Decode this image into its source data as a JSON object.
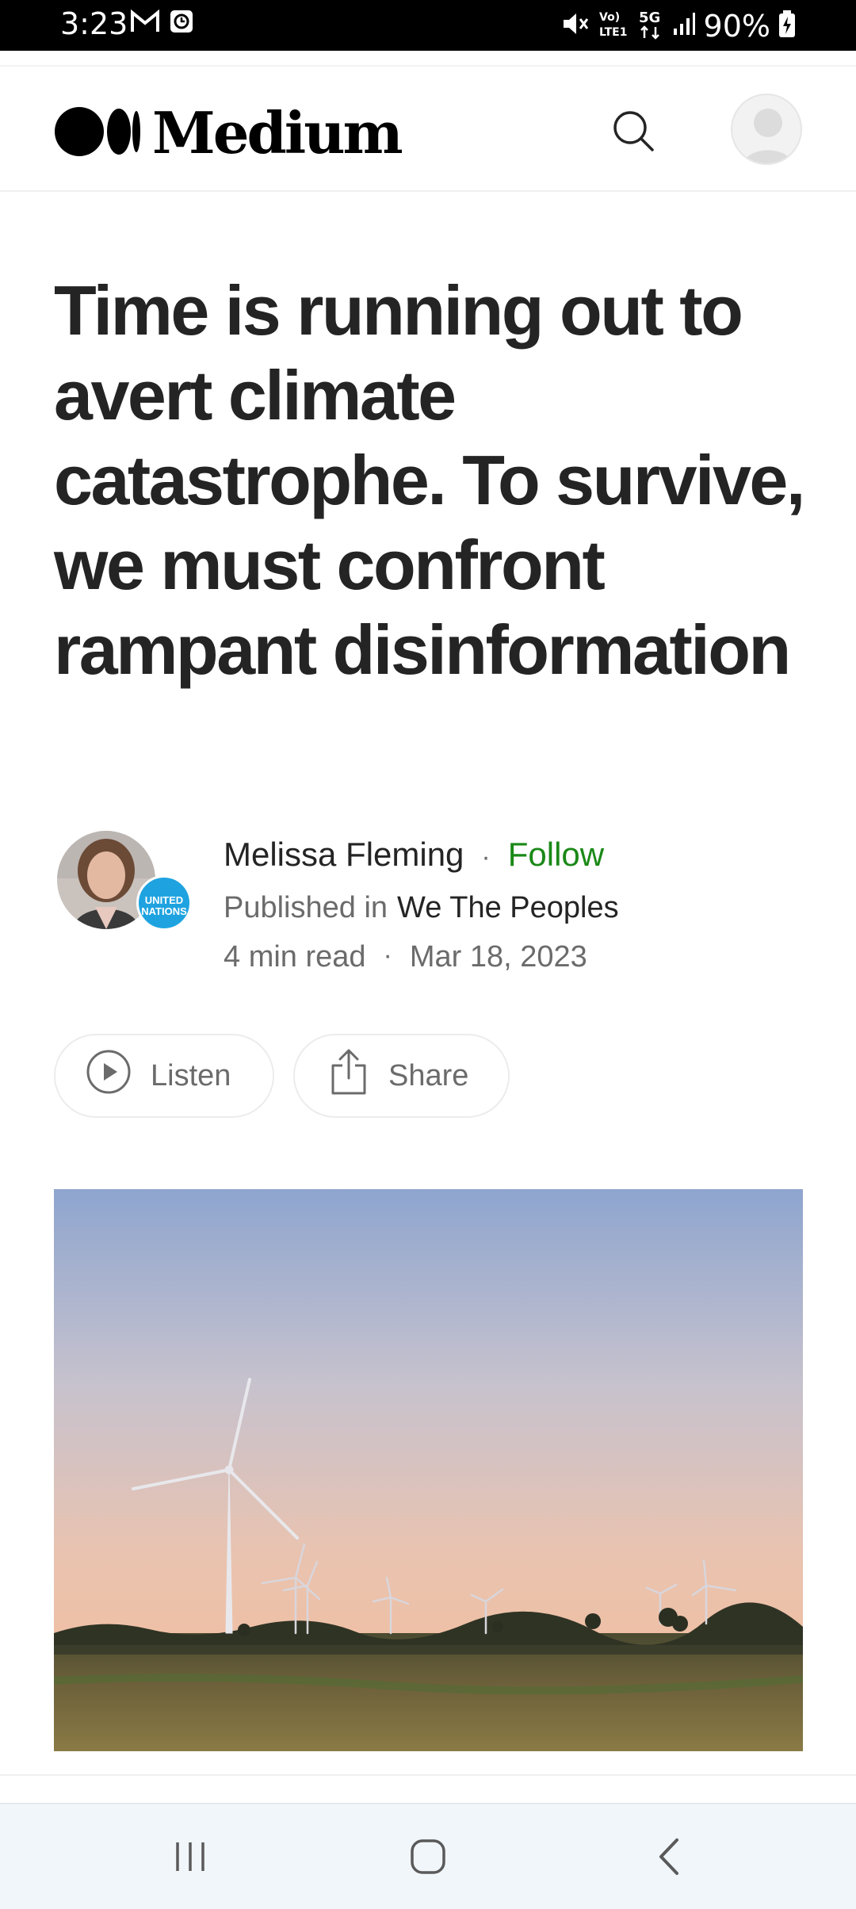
{
  "status_bar": {
    "time": "3:23",
    "battery": "90%",
    "icons": [
      "gmail-icon",
      "clock-app-icon",
      "mute-icon",
      "volte-icon",
      "5g-icon",
      "signal-icon",
      "battery-charging-icon"
    ]
  },
  "header": {
    "logo_text": "Medium",
    "icons": [
      "medium-logo-icon",
      "search-icon",
      "profile-avatar-icon"
    ]
  },
  "article": {
    "title": "Time is running out to avert climate catastrophe. To survive, we must confront rampant disinformation",
    "author": "Melissa Fleming",
    "separator": "·",
    "follow_label": "Follow",
    "published_label": "Published in",
    "publication": "We The Peoples",
    "read_time": "4 min read",
    "date": "Mar 18, 2023",
    "badge_text": "UNITED NATIONS"
  },
  "actions": {
    "listen_label": "Listen",
    "share_label": "Share"
  },
  "nav": {
    "icons": [
      "recent-apps-icon",
      "home-icon",
      "back-icon"
    ]
  },
  "colors": {
    "follow_green": "#1a8917",
    "text_primary": "#242424",
    "text_secondary": "#6b6b6b",
    "badge_blue": "#1fa3e0"
  }
}
